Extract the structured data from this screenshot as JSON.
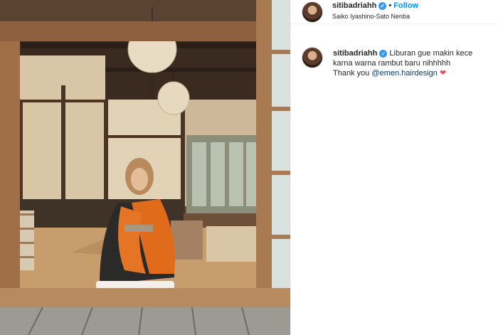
{
  "post": {
    "username": "sitibadriahh",
    "follow_label": "Follow",
    "location": "Saiko Iyashino-Sato Nenba",
    "caption_text": "Liburan gue makin kece karna warna rambut baru nihhhhh",
    "caption_line2_prefix": "Thank you ",
    "mention": "@emen.hairdesign",
    "heart": "❤"
  },
  "colors": {
    "accent": "#0095f6",
    "verified": "#3897f0",
    "mention": "#00376b",
    "heart": "#ed4956"
  }
}
